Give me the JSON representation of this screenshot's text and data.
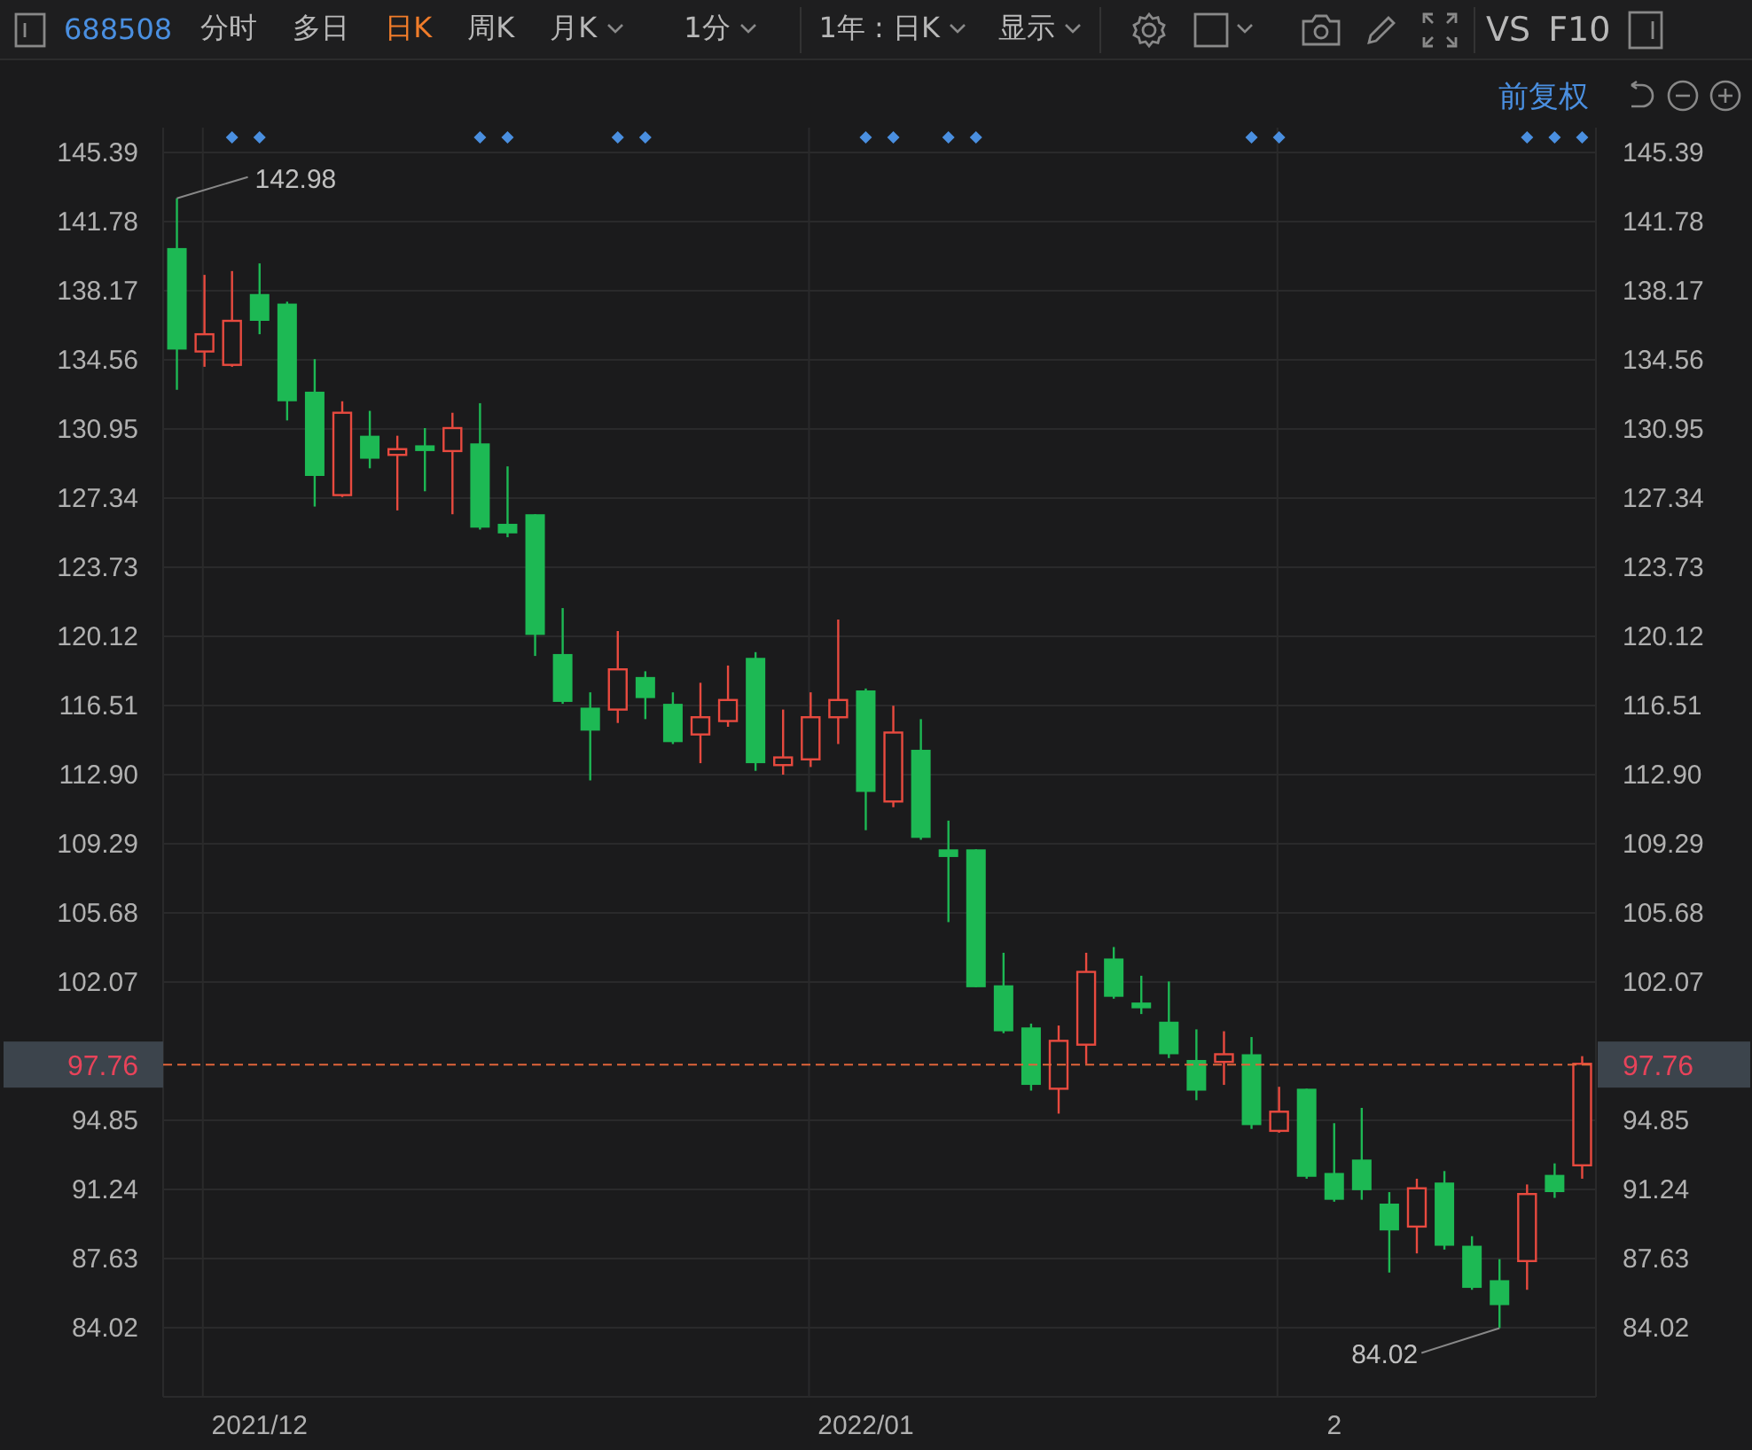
{
  "toolbar": {
    "code": "688508",
    "tabs": [
      {
        "label": "分时",
        "selected": false,
        "dropdown": false
      },
      {
        "label": "多日",
        "selected": false,
        "dropdown": false
      },
      {
        "label": "日K",
        "selected": true,
        "dropdown": false
      },
      {
        "label": "周K",
        "selected": false,
        "dropdown": false
      },
      {
        "label": "月K",
        "selected": false,
        "dropdown": true
      },
      {
        "label": "1分",
        "selected": false,
        "dropdown": true
      }
    ],
    "period": "1年 : 日K",
    "display": "显示",
    "compare": "VS",
    "f10": "F10"
  },
  "subbar": {
    "adjust": "前复权"
  },
  "chart": {
    "chart_data": {
      "type": "candlestick",
      "grid": true,
      "ylim": [
        80.41,
        146.69
      ],
      "yticks": [
        {
          "value": 145.39,
          "label": "145.39"
        },
        {
          "value": 141.78,
          "label": "141.78"
        },
        {
          "value": 138.17,
          "label": "138.17"
        },
        {
          "value": 134.56,
          "label": "134.56"
        },
        {
          "value": 130.95,
          "label": "130.95"
        },
        {
          "value": 127.34,
          "label": "127.34"
        },
        {
          "value": 123.73,
          "label": "123.73"
        },
        {
          "value": 120.12,
          "label": "120.12"
        },
        {
          "value": 116.51,
          "label": "116.51"
        },
        {
          "value": 112.9,
          "label": "112.90"
        },
        {
          "value": 109.29,
          "label": "109.29"
        },
        {
          "value": 105.68,
          "label": "105.68"
        },
        {
          "value": 102.07,
          "label": "102.07"
        },
        {
          "value": 94.85,
          "label": "94.85"
        },
        {
          "value": 91.24,
          "label": "91.24"
        },
        {
          "value": 87.63,
          "label": "87.63"
        },
        {
          "value": 84.02,
          "label": "84.02"
        }
      ],
      "categories": [
        null,
        null,
        null,
        "2021/12",
        null,
        null,
        null,
        null,
        null,
        null,
        null,
        null,
        null,
        null,
        null,
        null,
        null,
        null,
        null,
        null,
        null,
        null,
        null,
        null,
        null,
        "2022/01",
        null,
        null,
        null,
        null,
        null,
        null,
        null,
        null,
        null,
        null,
        null,
        null,
        null,
        null,
        null,
        null,
        "2",
        null,
        null,
        null,
        null,
        null,
        null,
        null,
        null,
        null
      ],
      "ohlc": [
        [
          140.4,
          143.0,
          133.0,
          135.1
        ],
        [
          135.0,
          139.0,
          134.2,
          135.9
        ],
        [
          134.3,
          139.2,
          134.2,
          136.6
        ],
        [
          138.0,
          139.6,
          135.9,
          136.6
        ],
        [
          137.5,
          137.6,
          131.4,
          132.4
        ],
        [
          132.9,
          134.6,
          126.9,
          128.5
        ],
        [
          127.5,
          132.4,
          127.4,
          131.8
        ],
        [
          130.6,
          131.9,
          128.9,
          129.4
        ],
        [
          129.6,
          130.6,
          126.7,
          129.9
        ],
        [
          130.1,
          131.0,
          127.7,
          129.8
        ],
        [
          129.8,
          131.8,
          126.5,
          131.0
        ],
        [
          130.2,
          132.3,
          125.7,
          125.8
        ],
        [
          126.0,
          129.0,
          125.3,
          125.5
        ],
        [
          126.5,
          126.5,
          119.1,
          120.2
        ],
        [
          119.2,
          121.6,
          116.6,
          116.7
        ],
        [
          116.4,
          117.2,
          112.6,
          115.2
        ],
        [
          116.3,
          120.4,
          115.6,
          118.4
        ],
        [
          118.0,
          118.3,
          115.8,
          116.9
        ],
        [
          116.6,
          117.2,
          114.5,
          114.6
        ],
        [
          115.0,
          117.7,
          113.5,
          115.9
        ],
        [
          115.7,
          118.6,
          115.4,
          116.8
        ],
        [
          119.0,
          119.3,
          113.1,
          113.5
        ],
        [
          113.4,
          116.3,
          112.9,
          113.8
        ],
        [
          113.7,
          117.2,
          113.3,
          115.9
        ],
        [
          115.9,
          121.0,
          114.5,
          116.8
        ],
        [
          117.3,
          117.4,
          110.0,
          112.0
        ],
        [
          111.5,
          116.5,
          111.2,
          115.1
        ],
        [
          114.2,
          115.8,
          109.5,
          109.6
        ],
        [
          109.0,
          110.5,
          105.2,
          108.6
        ],
        [
          109.0,
          109.0,
          101.8,
          101.8
        ],
        [
          101.9,
          103.6,
          99.4,
          99.5
        ],
        [
          99.7,
          99.9,
          96.4,
          96.7
        ],
        [
          96.5,
          99.8,
          95.2,
          99.0
        ],
        [
          98.8,
          103.6,
          97.8,
          102.6
        ],
        [
          103.3,
          103.9,
          101.2,
          101.3
        ],
        [
          101.0,
          102.4,
          100.4,
          100.7
        ],
        [
          100.0,
          102.1,
          98.1,
          98.3
        ],
        [
          98.0,
          99.6,
          95.9,
          96.4
        ],
        [
          97.9,
          99.5,
          96.7,
          98.3
        ],
        [
          98.3,
          99.2,
          94.4,
          94.6
        ],
        [
          94.3,
          96.6,
          94.2,
          95.3
        ],
        [
          96.5,
          96.5,
          91.8,
          91.9
        ],
        [
          92.1,
          94.7,
          90.6,
          90.7
        ],
        [
          92.8,
          95.5,
          90.7,
          91.2
        ],
        [
          90.5,
          91.1,
          86.9,
          89.1
        ],
        [
          89.3,
          91.8,
          87.9,
          91.3
        ],
        [
          91.6,
          92.2,
          88.1,
          88.3
        ],
        [
          88.3,
          88.8,
          86.0,
          86.1
        ],
        [
          86.5,
          87.6,
          84.0,
          85.2
        ],
        [
          87.5,
          91.5,
          86.0,
          91.0
        ],
        [
          92.0,
          92.6,
          90.8,
          91.1
        ],
        [
          92.5,
          98.2,
          91.8,
          97.8
        ]
      ],
      "ref_lines": [
        {
          "axis": "y",
          "value": 97.76,
          "label": "97.76"
        }
      ],
      "annotations": [
        "142.98",
        "84.02",
        "97.76"
      ]
    }
  }
}
